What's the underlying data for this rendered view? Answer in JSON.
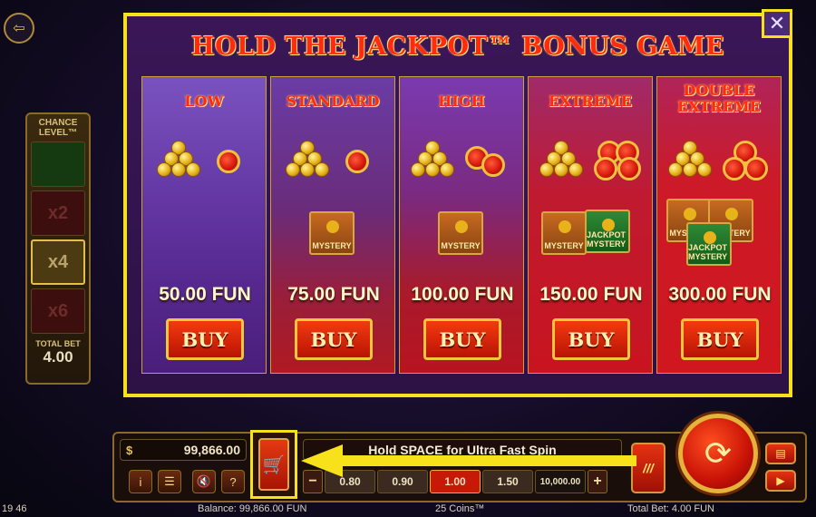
{
  "exit_icon": "exit-door-icon",
  "chance_panel": {
    "title": "CHANCE LEVEL™",
    "slots": [
      "",
      "x2",
      "x4",
      "x6"
    ],
    "total_bet_label": "TOTAL BET",
    "total_bet_value": "4.00"
  },
  "popup": {
    "title": "HOLD THE JACKPOT™ BONUS GAME",
    "close_icon": "close-icon",
    "tiers": [
      {
        "name": "LOW",
        "price": "50.00 FUN",
        "buy_label": "BUY",
        "mystery": []
      },
      {
        "name": "STANDARD",
        "price": "75.00 FUN",
        "buy_label": "BUY",
        "mystery": [
          "MYSTERY"
        ]
      },
      {
        "name": "HIGH",
        "price": "100.00 FUN",
        "buy_label": "BUY",
        "mystery": [
          "MYSTERY"
        ]
      },
      {
        "name": "EXTREME",
        "price": "150.00 FUN",
        "buy_label": "BUY",
        "mystery": [
          "MYSTERY",
          "JACKPOT MYSTERY"
        ]
      },
      {
        "name": "DOUBLE EXTREME",
        "price": "300.00 FUN",
        "buy_label": "BUY",
        "mystery": [
          "MYSTERY",
          "MYSTERY",
          "JACKPOT MYSTERY"
        ]
      }
    ]
  },
  "bottom_bar": {
    "balance_amount": "99,866.00",
    "spin_hint": "Hold SPACE for Ultra Fast Spin",
    "coin_values": [
      "0.80",
      "0.90",
      "1.00",
      "1.50",
      "10,000.00"
    ],
    "selected_coin": "1.00",
    "minus": "−",
    "plus": "+",
    "info": "i",
    "menu": "☰",
    "mute": "🔇",
    "help": "?",
    "turbo": "///",
    "spin_icon": "spin-arrows-icon"
  },
  "status": {
    "time": "19 46",
    "balance": "Balance: 99,866.00 FUN",
    "coins": "25 Coins™",
    "total_bet": "Total Bet: 4.00 FUN"
  },
  "colors": {
    "highlight_border": "#f6e11b",
    "title_red": "#ff2b10",
    "price_text": "#fff7c8"
  }
}
